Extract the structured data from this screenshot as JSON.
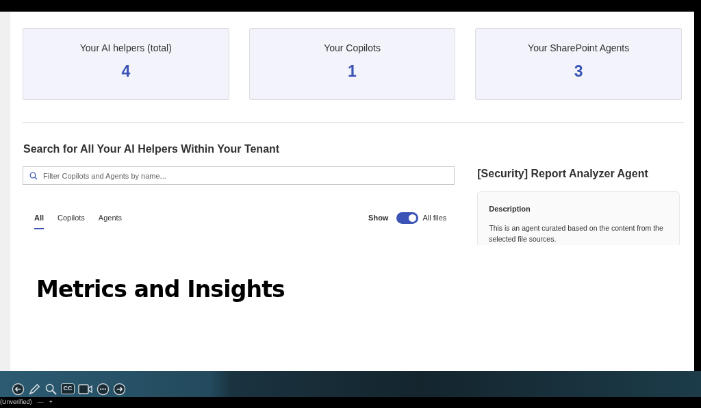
{
  "stats": [
    {
      "label": "Your AI helpers (total)",
      "value": "4"
    },
    {
      "label": "Your Copilots",
      "value": "1"
    },
    {
      "label": "Your SharePoint Agents",
      "value": "3"
    }
  ],
  "search": {
    "heading": "Search for All Your AI Helpers Within Your Tenant",
    "placeholder": "Filter Copilots and Agents by name..."
  },
  "tabs": [
    {
      "label": "All",
      "selected": true
    },
    {
      "label": "Copilots",
      "selected": false
    },
    {
      "label": "Agents",
      "selected": false
    }
  ],
  "show_toggle": {
    "label": "Show",
    "on": true,
    "text": "All files"
  },
  "detail": {
    "title": "[Security] Report Analyzer Agent",
    "section": "Description",
    "text": "This is an agent curated based on the content from the selected file sources."
  },
  "slide_title": "Metrics and Insights",
  "toolbar": {
    "captions_label": "CC"
  },
  "status": {
    "label": "(Unverified)",
    "minus": "—",
    "plus": "+"
  }
}
